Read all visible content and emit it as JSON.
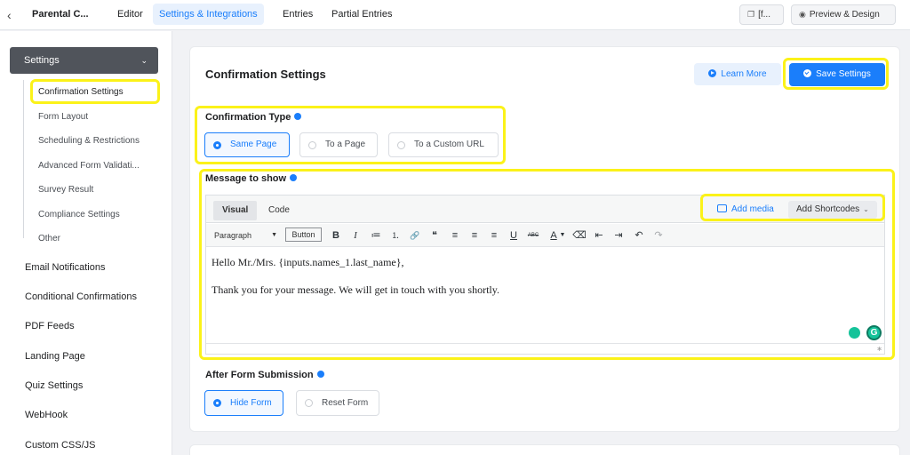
{
  "topbar": {
    "back_icon": "chevron-left-icon",
    "form_name": "Parental C...",
    "tabs": [
      "Editor",
      "Settings & Integrations",
      "Entries",
      "Partial Entries"
    ],
    "shortcode_btn": "[f...",
    "preview_btn": "Preview & Design"
  },
  "sidebar": {
    "section_title": "Settings",
    "sub_items": [
      "Confirmation Settings",
      "Form Layout",
      "Scheduling & Restrictions",
      "Advanced Form Validati...",
      "Survey Result",
      "Compliance Settings",
      "Other"
    ],
    "items": [
      "Email Notifications",
      "Conditional Confirmations",
      "PDF Feeds",
      "Landing Page",
      "Quiz Settings",
      "WebHook",
      "Custom CSS/JS"
    ]
  },
  "main": {
    "title": "Confirmation Settings",
    "learn_more": "Learn More",
    "save_settings": "Save Settings",
    "confirmation_type_label": "Confirmation Type",
    "confirmation_options": [
      "Same Page",
      "To a Page",
      "To a Custom URL"
    ],
    "confirmation_selected": "Same Page",
    "message_label": "Message to show",
    "editor": {
      "tabs": [
        "Visual",
        "Code"
      ],
      "add_media": "Add media",
      "add_shortcodes": "Add Shortcodes",
      "paragraph_select": "Paragraph",
      "button_chip": "Button",
      "tools": [
        "B",
        "I",
        "≔",
        "⒈",
        "🔗",
        "❝",
        "≡",
        "≡",
        "≡",
        "U",
        "ABC",
        "A",
        "⌫",
        "⇤",
        "⇥",
        "↶",
        "↷"
      ],
      "lines": [
        "Hello Mr./Mrs. {inputs.names_1.last_name},",
        "Thank you for your message. We will get in touch with you shortly."
      ]
    },
    "after_submission_label": "After Form Submission",
    "after_options": [
      "Hide Form",
      "Reset Form"
    ],
    "after_selected": "Hide Form"
  },
  "colors": {
    "accent": "#1a7efb",
    "highlight": "#fbf219",
    "sidebar_head": "#50545b"
  }
}
